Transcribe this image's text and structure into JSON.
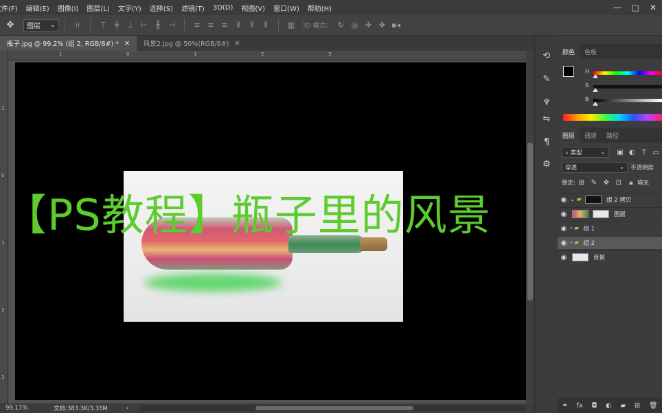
{
  "menu": {
    "items": [
      "文件(F)",
      "编辑(E)",
      "图像(I)",
      "图层(L)",
      "文字(Y)",
      "选择(S)",
      "滤镜(T)",
      "3D(D)",
      "视图(V)",
      "窗口(W)",
      "帮助(H)"
    ],
    "window_controls": [
      "—",
      "□",
      "✕"
    ]
  },
  "options": {
    "auto_select_value": "图层",
    "mode_3d_label": "3D 模式："
  },
  "tabs": [
    {
      "label": "瓶子.jpg @ 99.2% (组 2, RGB/8#) *",
      "close": "✕"
    },
    {
      "label": "风景2.jpg @ 50%(RGB/8#)",
      "close": "✕"
    }
  ],
  "rulers": {
    "top": [
      "1",
      "0",
      "1",
      "2",
      "3"
    ],
    "left": [
      "1",
      "0",
      "1",
      "2",
      "3"
    ]
  },
  "caption": "【PS教程】瓶子里的风景",
  "status": {
    "zoom": "99.17%",
    "doc_info": "文档:383.3K/3.35M",
    "arrow": "›"
  },
  "color_panel": {
    "tabs": [
      "颜色",
      "色板"
    ],
    "labels": [
      "H",
      "S",
      "B"
    ],
    "hsb_levels": [
      0,
      0,
      0
    ],
    "foreground": "#000000",
    "background": "#ffffff"
  },
  "layers_panel": {
    "tabs": [
      "图层",
      "通道",
      "路径"
    ],
    "filter_kind": "类型",
    "blend_mode": "穿透",
    "opacity_label": "不透明度",
    "lock_label": "锁定:",
    "fill_label": "填充",
    "layers": [
      {
        "name": "组 2 拷贝",
        "type": "group",
        "selected": false
      },
      {
        "name": "图层",
        "type": "layer",
        "selected": false
      },
      {
        "name": "组 1",
        "type": "group",
        "selected": false
      },
      {
        "name": "组 2",
        "type": "group",
        "selected": true
      },
      {
        "name": "背景",
        "type": "layer",
        "selected": false
      }
    ],
    "footer_icons": [
      "link-icon",
      "fx-icon",
      "mask-icon",
      "adjustment-icon",
      "folder-icon",
      "new-layer-icon",
      "trash-icon"
    ]
  }
}
